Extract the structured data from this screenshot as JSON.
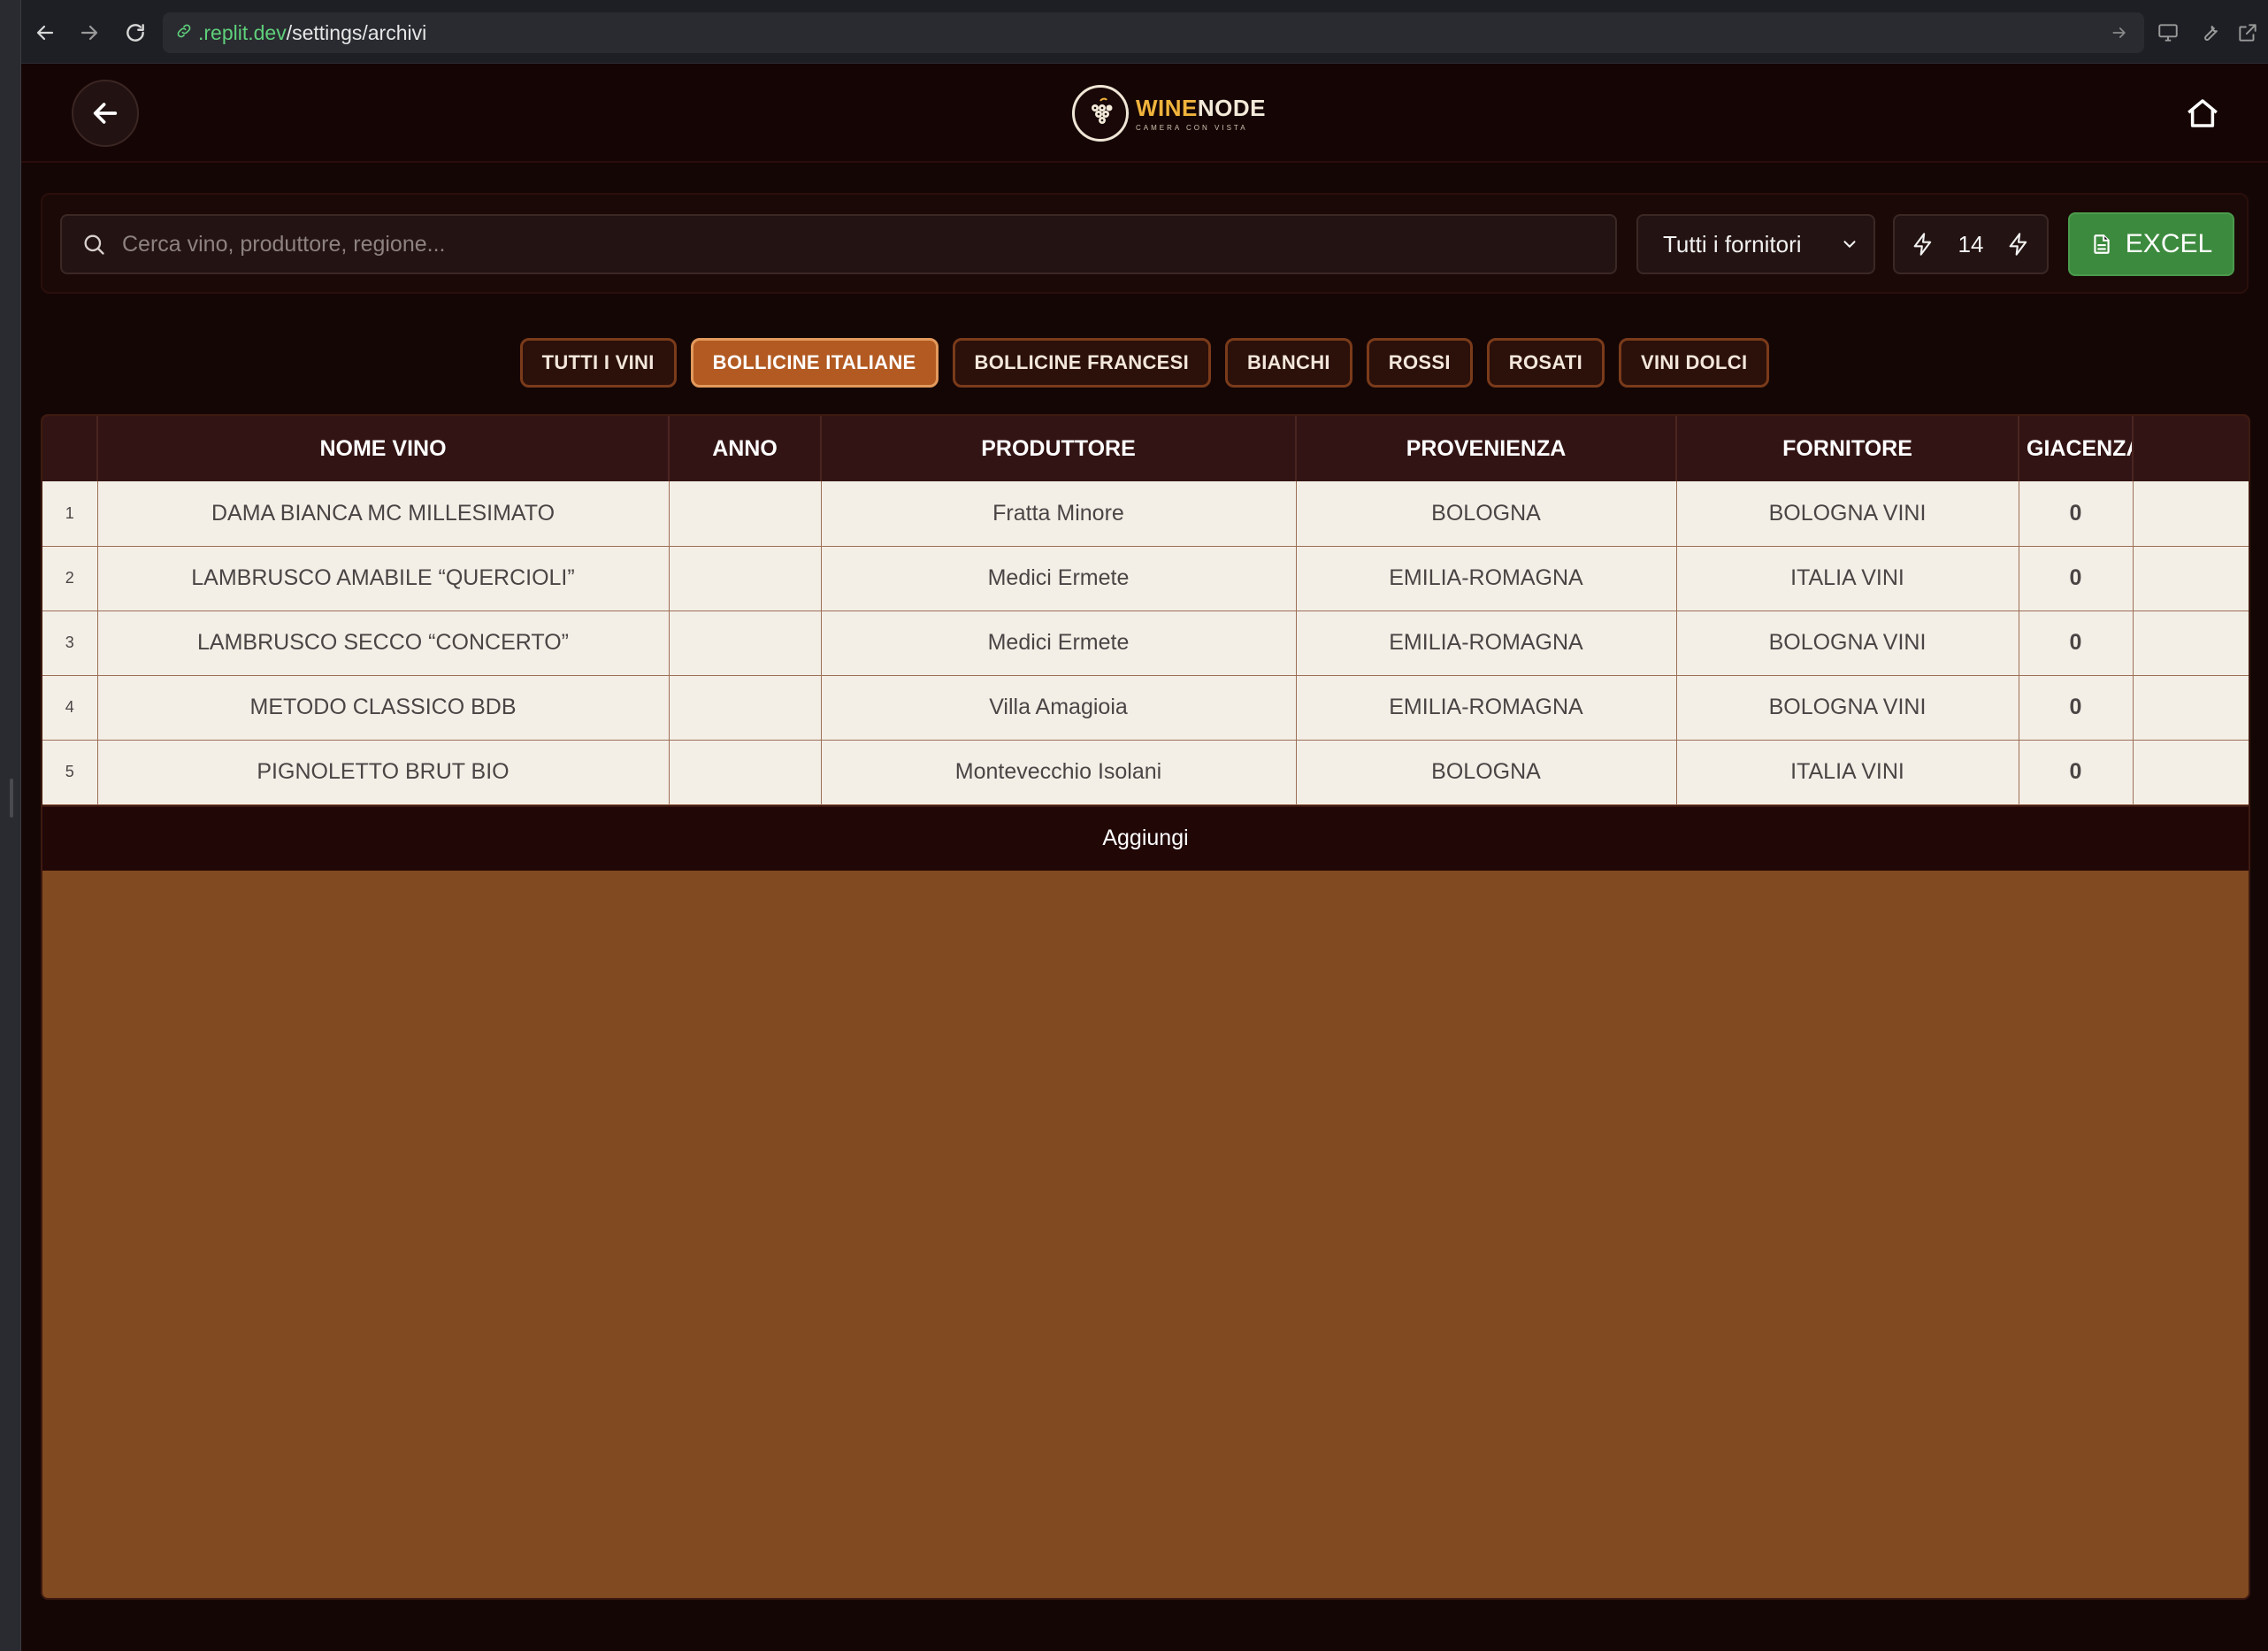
{
  "browser": {
    "url_host": ".replit.dev",
    "url_path": "/settings/archivi"
  },
  "header": {
    "logo_word1": "WINE",
    "logo_word2": "NODE",
    "logo_sub": "CAMERA CON VISTA"
  },
  "toolbar": {
    "search_placeholder": "Cerca vino, produttore, regione...",
    "supplier_selected": "Tutti i fornitori",
    "counter_value": "14",
    "excel_label": "EXCEL"
  },
  "tabs": [
    {
      "label": "TUTTI I VINI",
      "active": false
    },
    {
      "label": "BOLLICINE ITALIANE",
      "active": true
    },
    {
      "label": "BOLLICINE FRANCESI",
      "active": false
    },
    {
      "label": "BIANCHI",
      "active": false
    },
    {
      "label": "ROSSI",
      "active": false
    },
    {
      "label": "ROSATI",
      "active": false
    },
    {
      "label": "VINI DOLCI",
      "active": false
    }
  ],
  "table": {
    "columns": [
      "",
      "NOME VINO",
      "ANNO",
      "PRODUTTORE",
      "PROVENIENZA",
      "FORNITORE",
      "GIACENZA",
      ""
    ],
    "rows": [
      {
        "idx": "1",
        "nome": "DAMA BIANCA MC MILLESIMATO",
        "anno": "",
        "produttore": "Fratta Minore",
        "provenienza": "BOLOGNA",
        "fornitore": "BOLOGNA VINI",
        "giacenza": "0"
      },
      {
        "idx": "2",
        "nome": "LAMBRUSCO AMABILE “QUERCIOLI”",
        "anno": "",
        "produttore": "Medici Ermete",
        "provenienza": "EMILIA-ROMAGNA",
        "fornitore": "ITALIA VINI",
        "giacenza": "0"
      },
      {
        "idx": "3",
        "nome": "LAMBRUSCO SECCO “CONCERTO”",
        "anno": "",
        "produttore": "Medici Ermete",
        "provenienza": "EMILIA-ROMAGNA",
        "fornitore": "BOLOGNA VINI",
        "giacenza": "0"
      },
      {
        "idx": "4",
        "nome": "METODO CLASSICO BDB",
        "anno": "",
        "produttore": "Villa Amagioia",
        "provenienza": "EMILIA-ROMAGNA",
        "fornitore": "BOLOGNA VINI",
        "giacenza": "0"
      },
      {
        "idx": "5",
        "nome": "PIGNOLETTO BRUT BIO",
        "anno": "",
        "produttore": "Montevecchio Isolani",
        "provenienza": "BOLOGNA",
        "fornitore": "ITALIA VINI",
        "giacenza": "0"
      }
    ],
    "add_label": "Aggiungi"
  }
}
